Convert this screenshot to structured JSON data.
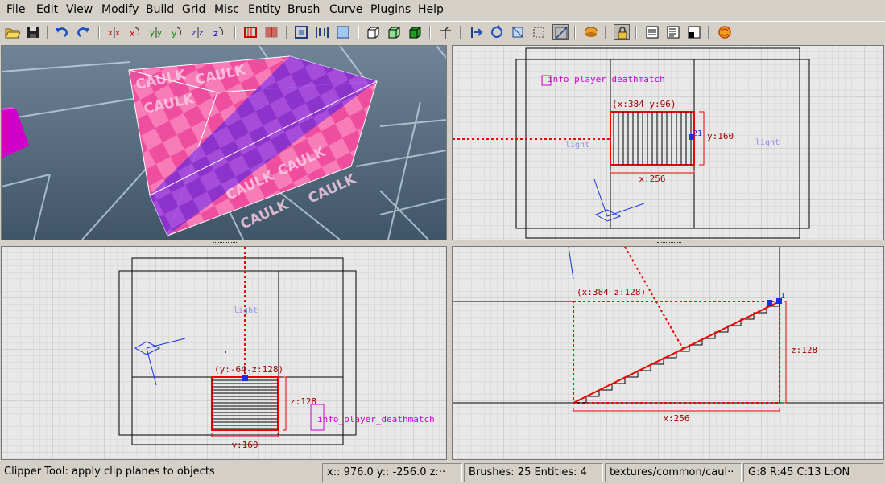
{
  "menu": [
    "File",
    "Edit",
    "View",
    "Modify",
    "Build",
    "Grid",
    "Misc",
    "Entity",
    "Brush",
    "Curve",
    "Plugins",
    "Help"
  ],
  "toolbar": [
    "open-icon",
    "save-icon",
    "undo-icon",
    "redo-icon",
    "flip-x-icon",
    "rotate-x-icon",
    "flip-y-icon",
    "rotate-y-icon",
    "flip-z-icon",
    "rotate-z-icon",
    "csg-subtract-icon",
    "csg-merge-icon",
    "csg-hollow-icon",
    "csg-room-icon",
    "select-inside-icon",
    "select-touching-icon",
    "select-partial-icon",
    "select-complete-icon",
    "make-detail-icon",
    "make-structural-icon",
    "texture-lock-icon",
    "patch-icon",
    "clipper-icon",
    "entity-icon",
    "lock-icon",
    "texture-view-icon",
    "entity-list-icon",
    "console-icon",
    "plugin-icon"
  ],
  "viewports": {
    "camera": {
      "texture_word": "CAULK"
    },
    "xy": {
      "entity_label": "info_player_deathmatch",
      "coord_label": "(x:384  y:96)",
      "dim_y": "y:160",
      "dim_x": "x:256",
      "light_label1": "light",
      "light_label2": "light",
      "clip_num": "21"
    },
    "yz": {
      "light_label": "light",
      "coord_label": "(y:-64  z:128)",
      "dim_z": "z:128",
      "dim_y": "y:160",
      "entity_label": "info_player_deathmatch",
      "clip_num": "1"
    },
    "xz": {
      "coord_label": "(x:384  z:128)",
      "dim_z": "z:128",
      "dim_x": "x:256",
      "clip_num": "1"
    }
  },
  "status": {
    "message": "Clipper Tool: apply clip planes to objects",
    "coords": "x::  976.0  y:: -256.0  z:··",
    "counts": "Brushes: 25 Entities: 4",
    "texture": "textures/common/caul··",
    "grid": "G:8  R:45  C:13  L:ON"
  }
}
